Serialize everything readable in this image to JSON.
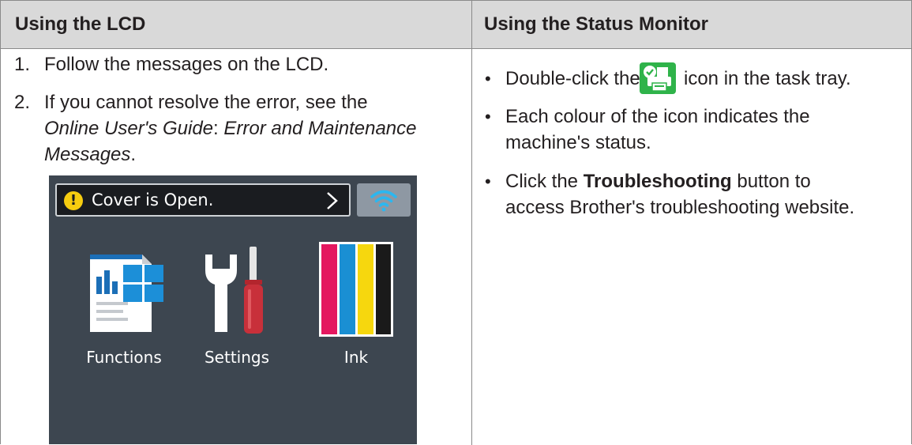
{
  "headers": {
    "lcd": "Using the LCD",
    "status_monitor": "Using the Status Monitor"
  },
  "lcd_steps": {
    "step1_number": "1.",
    "step1_text": "Follow the messages on the LCD.",
    "step2_number": "2.",
    "step2_text_a": "If you cannot resolve the error, see the",
    "step2_guide": "Online User's Guide",
    "step2_colon": ": ",
    "step2_topic_a": "Error and Maintenance",
    "step2_topic_b": "Messages",
    "step2_period": "."
  },
  "lcd_screen": {
    "status_message": "Cover is Open.",
    "warning_glyph": "!",
    "tiles": {
      "functions": "Functions",
      "settings": "Settings",
      "ink": "Ink"
    },
    "icons": [
      "warning-icon",
      "chevron-right-icon",
      "wifi-icon",
      "functions-icon",
      "settings-icon",
      "ink-icon"
    ]
  },
  "status_monitor": {
    "bullet": "•",
    "item1_before": "Double-click the",
    "item1_after": "icon in the task tray.",
    "item2_line1": "Each colour of the icon indicates the",
    "item2_line2": "machine's status.",
    "item3_before": "Click the",
    "item3_bold": "Troubleshooting",
    "item3_after": "button to",
    "item3_line2": "access Brother's troubleshooting website.",
    "icon": "status-monitor-tray-icon"
  },
  "colors": {
    "header_bg": "#d9d9d9",
    "lcd_bg": "#3d4650",
    "warning": "#f6cc10",
    "tray_icon_green": "#2fb34a",
    "ink_magenta": "#e4175f",
    "ink_cyan": "#1a8fd3",
    "ink_yellow": "#f6d70e",
    "ink_black": "#1a1a1a"
  }
}
